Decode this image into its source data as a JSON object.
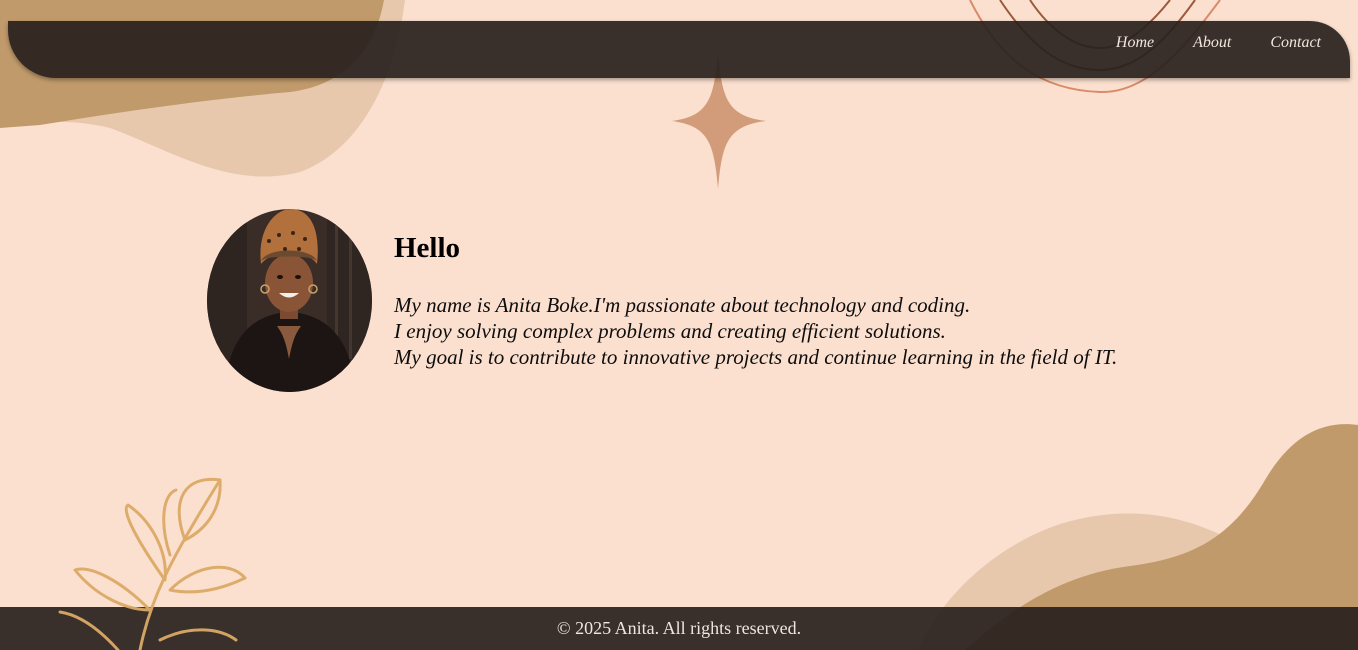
{
  "nav": {
    "items": [
      {
        "label": "Home"
      },
      {
        "label": "About"
      },
      {
        "label": "Contact"
      }
    ]
  },
  "main": {
    "heading": "Hello",
    "bio_lines": [
      "My name is Anita Boke.I'm passionate about technology and coding.",
      "I enjoy solving complex problems and creating efficient solutions.",
      "My goal is to contribute to innovative projects and continue learning in the field of IT."
    ]
  },
  "footer": {
    "text": "© 2025 Anita. All rights reserved."
  },
  "colors": {
    "background": "#fbe0cf",
    "bar": "#28211d",
    "blob_dark": "#c19a6b",
    "blob_light": "#e8c8ad",
    "star": "#d29c7a",
    "leaf": "#dcaa66"
  }
}
